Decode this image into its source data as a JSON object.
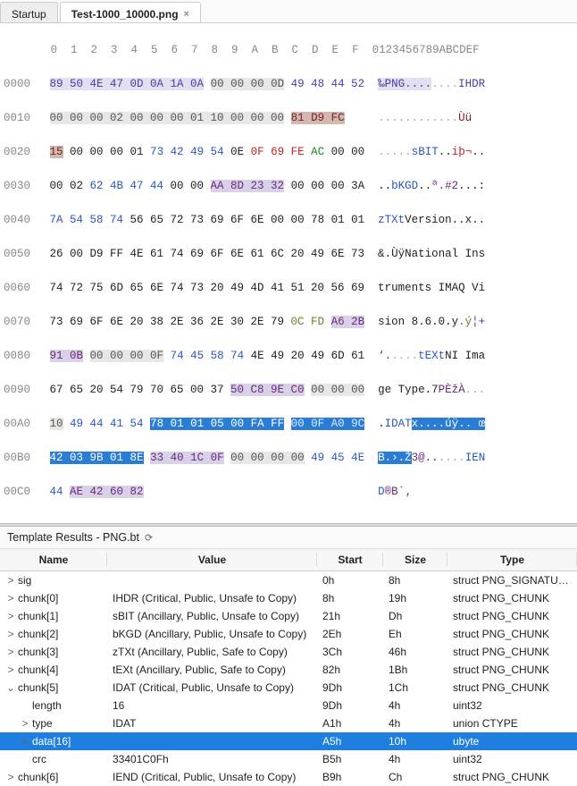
{
  "tabs": {
    "startup": "Startup",
    "active": "Test-1000_10000.png",
    "close_glyph": "×"
  },
  "hex": {
    "header": "       0  1  2  3  4  5  6  7  8  9  A  B  C  D  E  F  0123456789ABCDEF",
    "rows": [
      {
        "addr": "0000",
        "b": "89 50 4E 47 0D 0A 1A 0A 00 00 00 0D 49 48 44 52",
        "a": "‰PNG........IHDR"
      },
      {
        "addr": "0010",
        "b": "00 00 00 02 00 00 00 01 10 00 00 00 81 D9 FC     ",
        "a": "............Ùü"
      },
      {
        "addr": "0020",
        "b": "15 00 00 00 01 73 42 49 54 0E 0F 69 FE AC 00 00",
        "a": ".....sBIT..iþ¬.."
      },
      {
        "addr": "0030",
        "b": "00 02 62 4B 47 44 00 00 AA 8D 23 32 00 00 00 3A",
        "a": "..bKGD..ª.#2...:"
      },
      {
        "addr": "0040",
        "b": "7A 54 58 74 56 65 72 73 69 6F 6E 00 00 78 01 01",
        "a": "zTXtVersion..x.."
      },
      {
        "addr": "0050",
        "b": "26 00 D9 FF 4E 61 74 69 6F 6E 61 6C 20 49 6E 73",
        "a": "&.ÙÿNational Ins"
      },
      {
        "addr": "0060",
        "b": "74 72 75 6D 65 6E 74 73 20 49 4D 41 51 20 56 69",
        "a": "truments IMAQ Vi"
      },
      {
        "addr": "0070",
        "b": "73 69 6F 6E 20 38 2E 36 2E 30 2E 79 0C FD A6 2B",
        "a": "sion 8.6.0.y.ý¦+"
      },
      {
        "addr": "0080",
        "b": "91 0B 00 00 00 0F 74 45 58 74 4E 49 20 49 6D 61",
        "a": "‘.....tEXtNI Ima"
      },
      {
        "addr": "0090",
        "b": "67 65 20 54 79 70 65 00 37 50 C8 9E C0 00 00 00",
        "a": "ge Type.7PÈžÀ..."
      },
      {
        "addr": "00A0",
        "b": "10 49 44 41 54 78 01 01 05 00 FA FF 00 0F A0 9C",
        "a": ".IDATx....úÿ.. œ"
      },
      {
        "addr": "00B0",
        "b": "42 03 9B 01 8E 33 40 1C 0F 00 00 00 00 49 45 4E",
        "a": "B.›.Ž3@......IEN"
      },
      {
        "addr": "00C0",
        "b": "44 AE 42 60 82",
        "a": "D®B`‚"
      }
    ]
  },
  "templateResults": {
    "title": "Template Results - PNG.bt",
    "refresh_glyph": "⟳",
    "headers": {
      "name": "Name",
      "value": "Value",
      "start": "Start",
      "size": "Size",
      "type": "Type"
    },
    "rows": [
      {
        "tw": ">",
        "indent": 0,
        "name": "sig",
        "value": "",
        "start": "0h",
        "size": "8h",
        "type": "struct PNG_SIGNATURE"
      },
      {
        "tw": ">",
        "indent": 0,
        "name": "chunk[0]",
        "value": "IHDR  (Critical, Public, Unsafe to Copy)",
        "start": "8h",
        "size": "19h",
        "type": "struct PNG_CHUNK"
      },
      {
        "tw": ">",
        "indent": 0,
        "name": "chunk[1]",
        "value": "sBIT  (Ancillary, Public, Unsafe to Copy)",
        "start": "21h",
        "size": "Dh",
        "type": "struct PNG_CHUNK"
      },
      {
        "tw": ">",
        "indent": 0,
        "name": "chunk[2]",
        "value": "bKGD  (Ancillary, Public, Unsafe to Copy)",
        "start": "2Eh",
        "size": "Eh",
        "type": "struct PNG_CHUNK"
      },
      {
        "tw": ">",
        "indent": 0,
        "name": "chunk[3]",
        "value": "zTXt  (Ancillary, Public, Safe to Copy)",
        "start": "3Ch",
        "size": "46h",
        "type": "struct PNG_CHUNK"
      },
      {
        "tw": ">",
        "indent": 0,
        "name": "chunk[4]",
        "value": "tEXt  (Ancillary, Public, Safe to Copy)",
        "start": "82h",
        "size": "1Bh",
        "type": "struct PNG_CHUNK"
      },
      {
        "tw": "v",
        "indent": 0,
        "name": "chunk[5]",
        "value": "IDAT  (Critical, Public, Unsafe to Copy)",
        "start": "9Dh",
        "size": "1Ch",
        "type": "struct PNG_CHUNK"
      },
      {
        "tw": "",
        "indent": 1,
        "name": "length",
        "value": "16",
        "start": "9Dh",
        "size": "4h",
        "type": "uint32"
      },
      {
        "tw": ">",
        "indent": 1,
        "name": "type",
        "value": "IDAT",
        "start": "A1h",
        "size": "4h",
        "type": "union CTYPE"
      },
      {
        "tw": ">",
        "indent": 1,
        "name": "data[16]",
        "value": "",
        "start": "A5h",
        "size": "10h",
        "type": "ubyte",
        "selected": true
      },
      {
        "tw": "",
        "indent": 1,
        "name": "crc",
        "value": "33401C0Fh",
        "start": "B5h",
        "size": "4h",
        "type": "uint32"
      },
      {
        "tw": ">",
        "indent": 0,
        "name": "chunk[6]",
        "value": "IEND  (Critical, Public, Unsafe to Copy)",
        "start": "B9h",
        "size": "Ch",
        "type": "struct PNG_CHUNK"
      }
    ]
  }
}
